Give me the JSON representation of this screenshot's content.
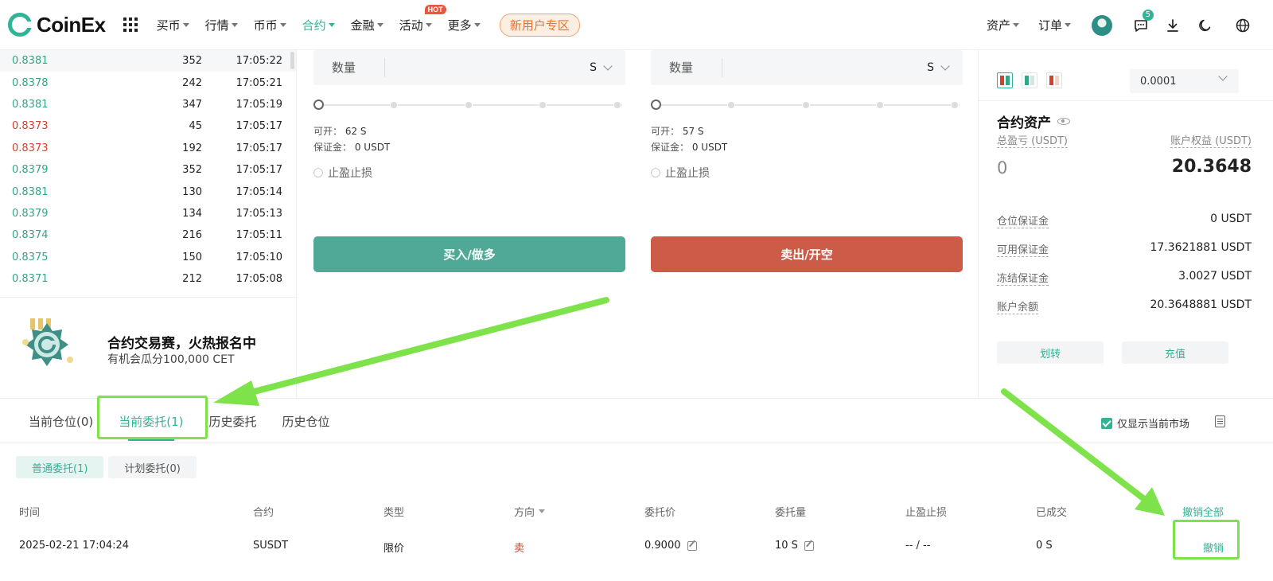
{
  "nav": {
    "brand": "CoinEx",
    "menu": [
      {
        "label": "买币",
        "active": false
      },
      {
        "label": "行情",
        "active": false
      },
      {
        "label": "币币",
        "active": false
      },
      {
        "label": "合约",
        "active": true
      },
      {
        "label": "金融",
        "active": false
      },
      {
        "label": "活动",
        "active": false,
        "badge": "HOT"
      },
      {
        "label": "更多",
        "active": false
      }
    ],
    "new_user": "新用户专区",
    "right_menu": [
      "资产",
      "订单"
    ],
    "message_count": "5"
  },
  "trades": [
    {
      "price": "0.8381",
      "qty": "352",
      "time": "17:05:22",
      "dir": "up"
    },
    {
      "price": "0.8378",
      "qty": "242",
      "time": "17:05:21",
      "dir": "up"
    },
    {
      "price": "0.8381",
      "qty": "347",
      "time": "17:05:19",
      "dir": "up"
    },
    {
      "price": "0.8373",
      "qty": "45",
      "time": "17:05:17",
      "dir": "down"
    },
    {
      "price": "0.8373",
      "qty": "192",
      "time": "17:05:17",
      "dir": "down"
    },
    {
      "price": "0.8379",
      "qty": "352",
      "time": "17:05:17",
      "dir": "up"
    },
    {
      "price": "0.8381",
      "qty": "130",
      "time": "17:05:14",
      "dir": "up"
    },
    {
      "price": "0.8379",
      "qty": "134",
      "time": "17:05:13",
      "dir": "up"
    },
    {
      "price": "0.8374",
      "qty": "216",
      "time": "17:05:11",
      "dir": "up"
    },
    {
      "price": "0.8375",
      "qty": "150",
      "time": "17:05:10",
      "dir": "up"
    },
    {
      "price": "0.8371",
      "qty": "212",
      "time": "17:05:08",
      "dir": "up"
    }
  ],
  "promo": {
    "title": "合约交易赛，火热报名中",
    "subtitle": "有机会瓜分100,000 CET"
  },
  "buy": {
    "qty_label": "数量",
    "unit": "S",
    "available_label": "可开：",
    "available": "62 S",
    "margin_label": "保证金：",
    "margin": "0 USDT",
    "tpsl_label": "止盈止损",
    "button": "买入/做多"
  },
  "sell": {
    "qty_label": "数量",
    "unit": "S",
    "available_label": "可开：",
    "available": "57 S",
    "margin_label": "保证金：",
    "margin": "0 USDT",
    "tpsl_label": "止盈止损",
    "button": "卖出/开空"
  },
  "assets": {
    "precision": "0.0001",
    "title": "合约资产",
    "total_pnl_label": "总盈亏 (USDT)",
    "equity_label": "账户权益 (USDT)",
    "total_pnl": "0",
    "equity": "20.3648",
    "rows": [
      {
        "label": "仓位保证金",
        "value": "0 USDT"
      },
      {
        "label": "可用保证金",
        "value": "17.3621881 USDT"
      },
      {
        "label": "冻结保证金",
        "value": "3.0027 USDT"
      },
      {
        "label": "账户余额",
        "value": "20.3648881 USDT"
      }
    ],
    "transfer": "划转",
    "deposit": "充值"
  },
  "orders": {
    "tabs": [
      {
        "label": "当前仓位(0)",
        "active": false
      },
      {
        "label": "当前委托(1)",
        "active": true
      },
      {
        "label": "历史委托",
        "active": false
      },
      {
        "label": "历史仓位",
        "active": false
      }
    ],
    "only_current": "仅显示当前市场",
    "subtabs": [
      {
        "label": "普通委托(1)",
        "active": true
      },
      {
        "label": "计划委托(0)",
        "active": false
      }
    ],
    "headers": {
      "time": "时间",
      "contract": "合约",
      "type": "类型",
      "direction": "方向",
      "price": "委托价",
      "amount": "委托量",
      "tpsl": "止盈止损",
      "filled": "已成交",
      "cancel_all": "撤销全部"
    },
    "row": {
      "time": "2025-02-21 17:04:24",
      "contract": "SUSDT",
      "type": "限价",
      "direction": "卖",
      "price": "0.9000",
      "amount": "10 S",
      "tpsl": "-- / --",
      "filled": "0 S",
      "cancel": "撤销"
    }
  },
  "colors": {
    "accent": "#2fb495",
    "buy": "#4fa996",
    "sell": "#cc5b48",
    "highlight": "#7ee34a"
  }
}
